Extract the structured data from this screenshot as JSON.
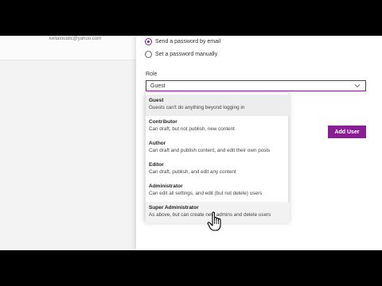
{
  "user": {
    "email": "kellalouatic@yahoo.com"
  },
  "password": {
    "options": [
      {
        "label": "Send a password by email",
        "checked": true
      },
      {
        "label": "Set a password manually",
        "checked": false
      }
    ]
  },
  "role": {
    "label": "Role",
    "selected": "Guest",
    "options": [
      {
        "title": "Guest",
        "description": "Guests can't do anything beyond logging in"
      },
      {
        "title": "Contributor",
        "description": "Can draft, but not publish, new content"
      },
      {
        "title": "Author",
        "description": "Can draft and publish content, and edit their own posts"
      },
      {
        "title": "Editor",
        "description": "Can draft, publish, and edit any content"
      },
      {
        "title": "Administrator",
        "description": "Can edit all settings, and edit (but not delete) users"
      },
      {
        "title": "Super Administrator",
        "description": "As above, but can create new admins and delete users"
      }
    ]
  },
  "actions": {
    "add_user_label": "Add User"
  },
  "colors": {
    "accent": "#8a1f93",
    "letterbox": "#000000"
  },
  "icons": {
    "dropdown": "chevron-down-icon",
    "cursor": "hand-pointer-icon"
  }
}
